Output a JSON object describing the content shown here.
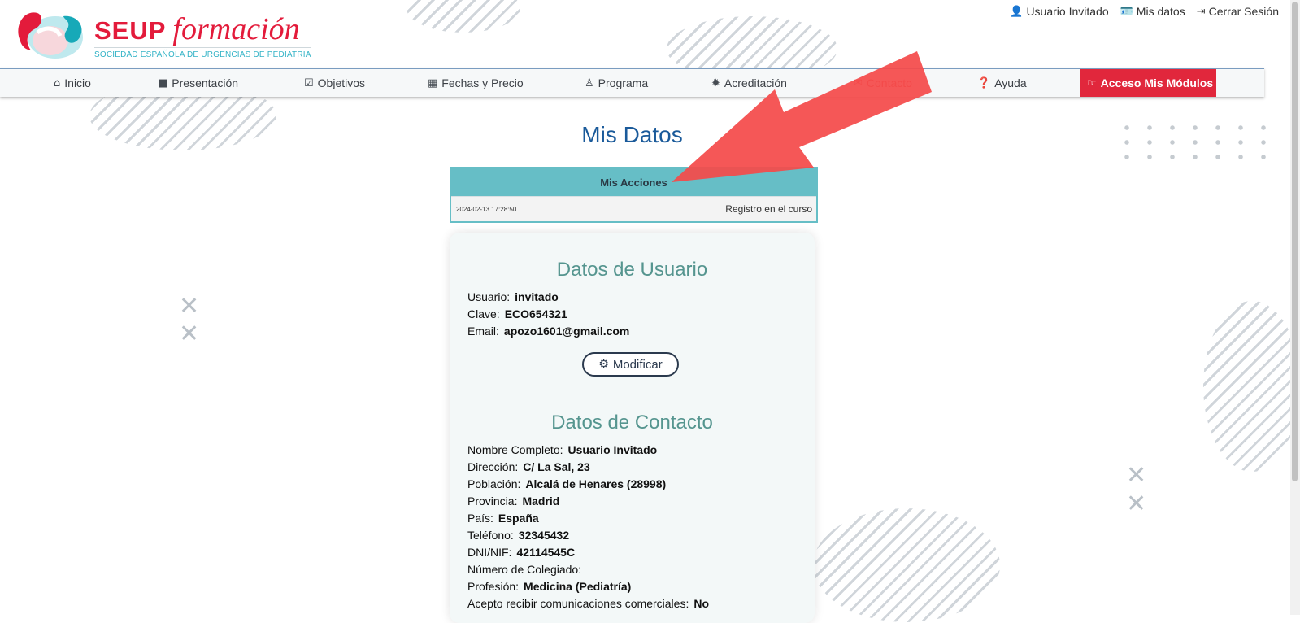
{
  "brand": {
    "name": "SEUP",
    "tagline": "formación",
    "subtitle": "SOCIEDAD ESPAÑOLA DE URGENCIAS DE PEDIATRIA"
  },
  "userbar": {
    "user": "Usuario Invitado",
    "my_data": "Mis datos",
    "logout": "Cerrar Sesión"
  },
  "nav": [
    {
      "label": "Inicio",
      "icon": "home-icon"
    },
    {
      "label": "Presentación",
      "icon": "video-icon"
    },
    {
      "label": "Objetivos",
      "icon": "checkbox-icon"
    },
    {
      "label": "Fechas y Precio",
      "icon": "calendar-icon"
    },
    {
      "label": "Programa",
      "icon": "user-tie-icon"
    },
    {
      "label": "Acreditación",
      "icon": "certificate-icon"
    },
    {
      "label": "Contacto",
      "icon": "envelope-icon"
    },
    {
      "label": "Ayuda",
      "icon": "question-circle-icon"
    },
    {
      "label": "Acceso Mis Módulos",
      "icon": "hand-point-right-icon"
    }
  ],
  "page": {
    "title": "Mis Datos"
  },
  "actions": {
    "header": "Mis Acciones",
    "rows": [
      {
        "date": "2024-02-13 17:28:50",
        "text": "Registro en el curso"
      }
    ]
  },
  "user_section": {
    "title": "Datos de Usuario",
    "fields": [
      {
        "label": "Usuario:",
        "value": "invitado"
      },
      {
        "label": "Clave:",
        "value": "ECO654321"
      },
      {
        "label": "Email:",
        "value": "apozo1601@gmail.com"
      }
    ],
    "modify_label": "Modificar"
  },
  "contact_section": {
    "title": "Datos de Contacto",
    "fields": [
      {
        "label": "Nombre Completo:",
        "value": "Usuario Invitado"
      },
      {
        "label": "Dirección:",
        "value": "C/ La Sal, 23"
      },
      {
        "label": "Población:",
        "value": "Alcalá de Henares (28998)"
      },
      {
        "label": "Provincia:",
        "value": "Madrid"
      },
      {
        "label": "País:",
        "value": "España"
      },
      {
        "label": "Teléfono:",
        "value": "32345432"
      },
      {
        "label": "DNI/NIF:",
        "value": "42114545C"
      },
      {
        "label": "Número de Colegiado:",
        "value": ""
      },
      {
        "label": "Profesión:",
        "value": "Medicina (Pediatría)"
      },
      {
        "label": "Acepto recibir comunicaciones comerciales:",
        "value": "No"
      }
    ]
  },
  "colors": {
    "brand_red": "#e31b3b",
    "brand_teal": "#33b3c6",
    "title_blue": "#1a5a9a",
    "section_green": "#55958f",
    "actions_teal": "#66bec6",
    "access_red": "#e1273c",
    "annotation_arrow": "#f44a4a"
  }
}
